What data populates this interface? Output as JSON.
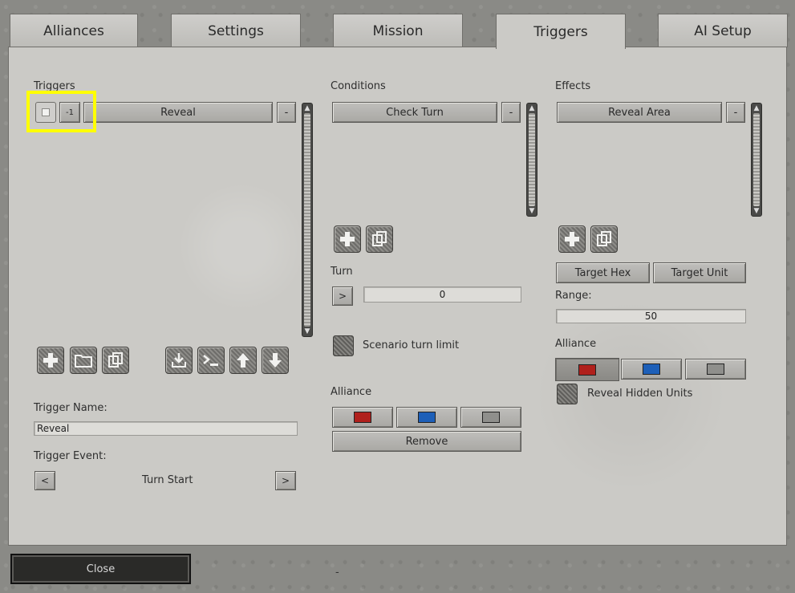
{
  "tabs": [
    {
      "label": "Alliances"
    },
    {
      "label": "Settings"
    },
    {
      "label": "Mission"
    },
    {
      "label": "Triggers"
    },
    {
      "label": "AI Setup"
    }
  ],
  "triggers": {
    "header": "Triggers",
    "list": [
      {
        "number": "-1",
        "name": "Reveal",
        "remove_label": "-"
      }
    ],
    "trigger_name_label": "Trigger Name:",
    "trigger_name_value": "Reveal",
    "trigger_event_label": "Trigger Event:",
    "trigger_event_value": "Turn Start",
    "prev_label": "<",
    "next_label": ">"
  },
  "conditions": {
    "header": "Conditions",
    "list": [
      {
        "name": "Check Turn",
        "remove_label": "-"
      }
    ],
    "turn_label": "Turn",
    "turn_button": ">",
    "turn_value": "0",
    "scenario_turn_limit_label": "Scenario turn limit",
    "alliance_label": "Alliance",
    "remove_label": "Remove"
  },
  "effects": {
    "header": "Effects",
    "list": [
      {
        "name": "Reveal Area",
        "remove_label": "-"
      }
    ],
    "target_hex_label": "Target Hex",
    "target_unit_label": "Target Unit",
    "range_label": "Range:",
    "range_value": "50",
    "alliance_label": "Alliance",
    "reveal_hidden_units_label": "Reveal Hidden Units"
  },
  "alliance_colors": {
    "red": "#b0201c",
    "blue": "#1d5fb8",
    "gray": "#8f8f8c"
  },
  "footer": {
    "close_label": "Close",
    "dash": "-"
  }
}
